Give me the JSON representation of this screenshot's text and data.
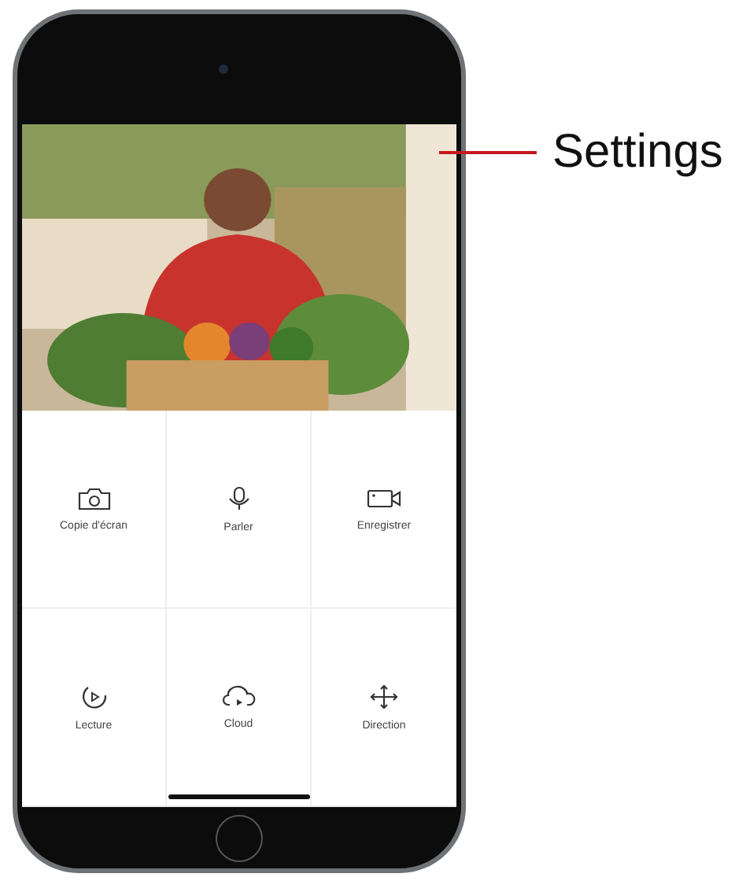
{
  "annotation": {
    "label": "Settings"
  },
  "screen": {
    "actions": [
      {
        "label": "Copie d'écran"
      },
      {
        "label": "Parler"
      },
      {
        "label": "Enregistrer"
      },
      {
        "label": "Lecture"
      },
      {
        "label": "Cloud"
      },
      {
        "label": "Direction"
      }
    ]
  }
}
